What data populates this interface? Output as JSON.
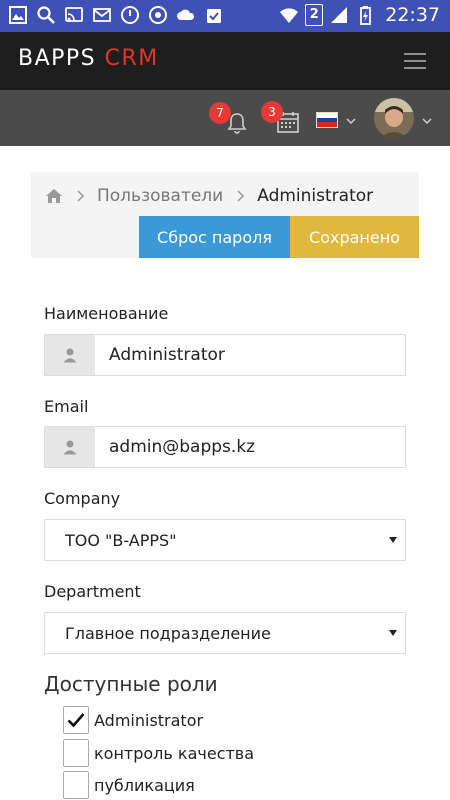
{
  "status_bar": {
    "sim_slot": "2",
    "time": "22:37",
    "color": "#3f51b5"
  },
  "header": {
    "brand_main": "BAPPS",
    "brand_accent": "CRM",
    "accent_color": "#e5322d"
  },
  "toolbar": {
    "notifications_count": "7",
    "calendar_count": "3",
    "language": "ru",
    "badge_color": "#e53a35"
  },
  "breadcrumb": {
    "items": [
      "Пользователи",
      "Administrator"
    ]
  },
  "actions": {
    "reset_password": "Сброс пароля",
    "saved": "Сохранено",
    "reset_color": "#3b99d8",
    "saved_color": "#e0b83e"
  },
  "form": {
    "name": {
      "label": "Наименование",
      "value": "Administrator"
    },
    "email": {
      "label": "Email",
      "value": "admin@bapps.kz"
    },
    "company": {
      "label": "Company",
      "selected": "ТОО \"B-APPS\""
    },
    "department": {
      "label": "Department",
      "selected": "Главное подразделение"
    }
  },
  "roles": {
    "title": "Доступные роли",
    "items": [
      {
        "label": "Administrator",
        "checked": true
      },
      {
        "label": "контроль качества",
        "checked": false
      },
      {
        "label": "публикация",
        "checked": false
      }
    ]
  }
}
